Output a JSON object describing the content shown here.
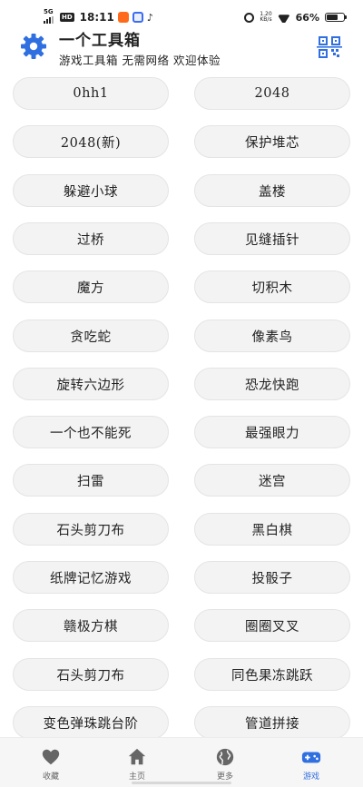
{
  "status_bar": {
    "network": "5G",
    "hd": "HD",
    "time": "18:11",
    "tiktok": "♪",
    "speed_value": "1.20",
    "speed_unit": "KB/s",
    "battery": "66%",
    "battery_level": 0.66
  },
  "header": {
    "title": "一个工具箱",
    "subtitle": "游戏工具箱 无需网络 欢迎体验",
    "gear_icon": "gear-icon",
    "qr_icon": "qr-scan-icon",
    "accent_color": "#2f6fe0"
  },
  "games": [
    "0hh1",
    "2048",
    "2048(新)",
    "保护堆芯",
    "躲避小球",
    "盖楼",
    "过桥",
    "见缝插针",
    "魔方",
    "切积木",
    "贪吃蛇",
    "像素鸟",
    "旋转六边形",
    "恐龙快跑",
    "一个也不能死",
    "最强眼力",
    "扫雷",
    "迷宫",
    "石头剪刀布",
    "黑白棋",
    "纸牌记忆游戏",
    "投骰子",
    "赣极方棋",
    "圈圈叉叉",
    "石头剪刀布",
    "同色果冻跳跃",
    "变色弹珠跳台阶",
    "管道拼接"
  ],
  "bottom_nav": [
    {
      "label": "收藏",
      "icon": "heart-icon",
      "active": false
    },
    {
      "label": "主页",
      "icon": "home-icon",
      "active": false
    },
    {
      "label": "更多",
      "icon": "globe-icon",
      "active": false
    },
    {
      "label": "游戏",
      "icon": "gamepad-icon",
      "active": true
    }
  ]
}
